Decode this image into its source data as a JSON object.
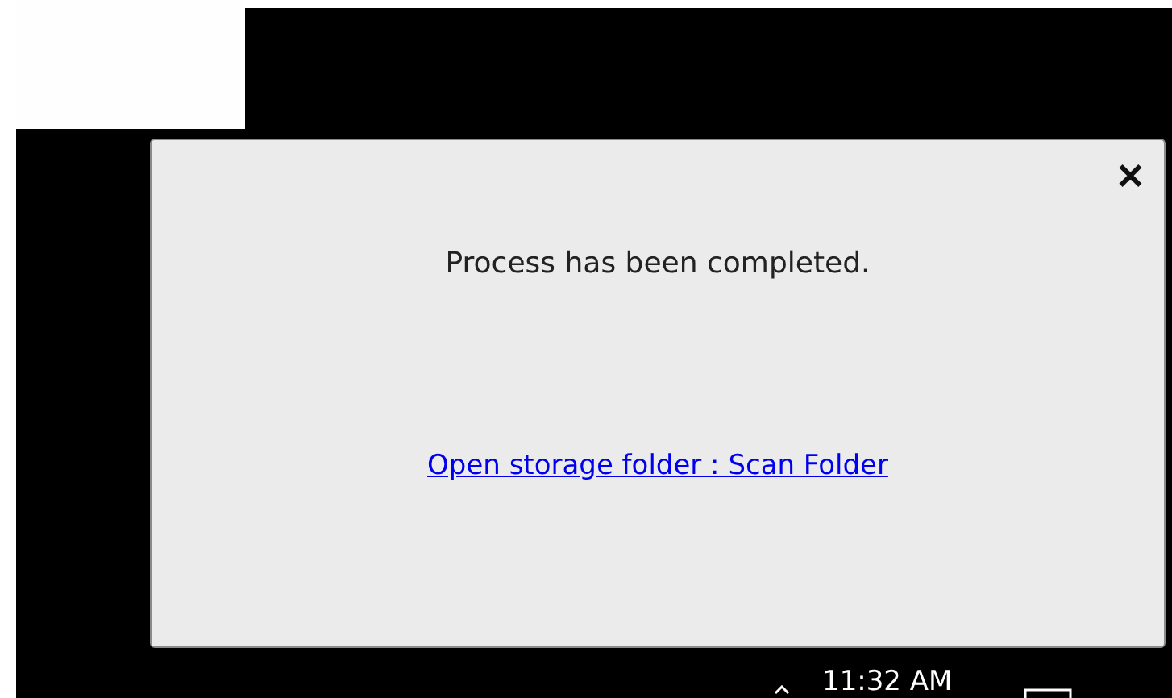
{
  "notification": {
    "message": "Process has been completed.",
    "link": "Open storage folder : Scan Folder",
    "close": "✕"
  },
  "taskbar": {
    "time": "11:32 AM"
  }
}
